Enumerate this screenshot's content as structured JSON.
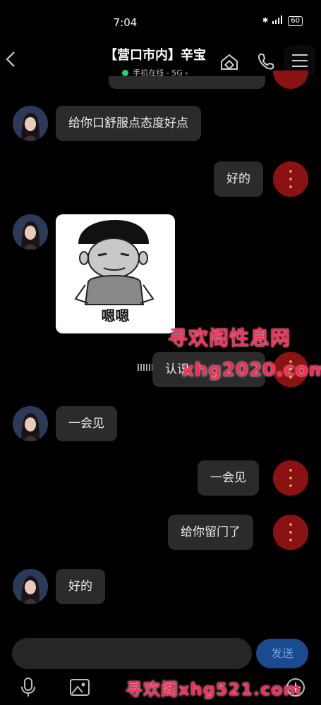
{
  "status": {
    "time": "7:04",
    "network": "5G",
    "battery": "60"
  },
  "header": {
    "back_symbol": "‹",
    "title": "【营口市内】辛宝",
    "online_status": "手机在线 - 5G",
    "chevron": "›"
  },
  "messages": [
    {
      "side": "left",
      "text": "给你口舒服点态度好点"
    },
    {
      "side": "right",
      "text": "好的"
    },
    {
      "side": "left",
      "type": "sticker",
      "caption": "嗯嗯"
    },
    {
      "side": "right",
      "text": "认识"
    },
    {
      "side": "left",
      "text": "一会见"
    },
    {
      "side": "right",
      "text": "一会见"
    },
    {
      "side": "right",
      "text": "给你留门了"
    },
    {
      "side": "left",
      "text": "好的"
    }
  ],
  "watermarks": {
    "line1": "寻欢阁性息网",
    "line2": "xhg2020.com",
    "bottom": "寻欢阁xhg521.com"
  },
  "input": {
    "send_label": "发送"
  },
  "colors": {
    "bubble": "#2b2b2b",
    "send": "#1a4a8f",
    "online": "#2ccf72",
    "watermark": "#ff2a55"
  }
}
